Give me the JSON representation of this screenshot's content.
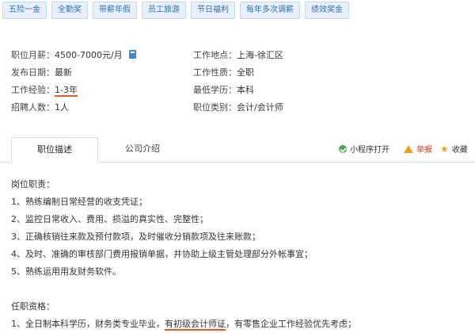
{
  "tags": [
    "五险一金",
    "全勤奖",
    "带薪年假",
    "员工旅游",
    "节日福利",
    "每年多次调薪",
    "绩效奖金"
  ],
  "info": {
    "salary_label": "职位月薪：",
    "salary_value": "4500-7000元/月",
    "location_label": "工作地点：",
    "location_value": "上海-徐汇区",
    "date_label": "发布日期：",
    "date_value": "最新",
    "nature_label": "工作性质：",
    "nature_value": "全职",
    "exp_label": "工作经验：",
    "exp_value": "1-3年",
    "edu_label": "最低学历：",
    "edu_value": "本科",
    "count_label": "招聘人数：",
    "count_value": "1人",
    "category_label": "职位类别：",
    "category_value": "会计/会计师"
  },
  "tabs": {
    "active": "职位描述",
    "inactive": "公司介绍",
    "mini_program": "小程序打开",
    "report": "举报",
    "favorite": "收藏"
  },
  "desc": {
    "duty_title": "岗位职责：",
    "duties": [
      "1、熟练编制日常经营的收支凭证；",
      "2、监控日常收入、费用、损溢的真实性、完整性；",
      "3、正确核销往来款及预付款项，及时催收分销款项及往来账款；",
      "4、及时、准确的审核部门费用报销单据，并协助上级主管处理部分外帐事宜；",
      "5、熟练运用用友财务软件。"
    ],
    "req_title": "任职资格：",
    "req1_prefix": "1、全日制本科学历，财务类专业毕业，",
    "req1_highlight": "有初级会计师证",
    "req1_suffix": "，有零售企业工作经验优先考虑；"
  },
  "colors": {
    "tag_text": "#2f6fb0",
    "tag_bg": "#e8f1fb",
    "highlight_underline": "#e05a2a",
    "report_red": "#d04030"
  }
}
